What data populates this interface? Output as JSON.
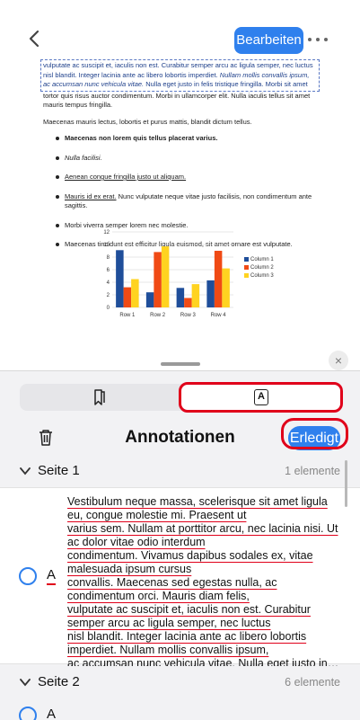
{
  "toolbar": {
    "edit_label": "Bearbeiten"
  },
  "document": {
    "highlight_lines": [
      "vulputate ac suscipit et, iaculis non est. Curabitur semper arcu ac ligula semper, nec luctus",
      "nisl blandit. Integer lacinia ante ac libero lobortis imperdiet.",
      "Nullam mollis convallis ipsum,",
      "ac accumsan nunc vehicula vitae.",
      "Nulla eget justo in felis tristique fringilla. Morbi sit amet"
    ],
    "para1_rest": "tortor quis risus auctor condimentum. Morbi in ullamcorper elit. Nulla iaculis tellus sit amet mauris tempus fringilla.",
    "para2": "Maecenas mauris lectus, lobortis et purus mattis, blandit dictum tellus.",
    "bullets": [
      "Maecenas non lorem quis tellus placerat varius.",
      "Nulla facilisi.",
      "Aenean congue fringilla justo ut aliquam.",
      "Mauris id ex erat.",
      "Nunc vulputate neque vitae justo facilisis, non condimentum ante sagittis.",
      "Morbi viverra semper lorem nec molestie.",
      "Maecenas tincidunt est efficitur ligula euismod, sit amet ornare est vulputate."
    ]
  },
  "chart_data": {
    "type": "bar",
    "categories": [
      "Row 1",
      "Row 2",
      "Row 3",
      "Row 4"
    ],
    "series": [
      {
        "name": "Column 1",
        "values": [
          9.1,
          2.4,
          3.1,
          4.3
        ],
        "color": "#1f4e9a"
      },
      {
        "name": "Column 2",
        "values": [
          3.2,
          8.8,
          1.5,
          9.0
        ],
        "color": "#f04a15"
      },
      {
        "name": "Column 3",
        "values": [
          4.5,
          9.7,
          3.7,
          6.2
        ],
        "color": "#ffd320"
      }
    ],
    "ylim": [
      0,
      12
    ],
    "yticks": [
      "0",
      "2",
      "4",
      "6",
      "8",
      "10",
      "12"
    ],
    "grid": true,
    "legend": "right"
  },
  "sheet": {
    "title": "Annotationen",
    "done_label": "Erledigt",
    "close_symbol": "×",
    "annot_tab_letter": "A"
  },
  "sections": [
    {
      "label": "Seite 1",
      "count": "1 elemente"
    },
    {
      "label": "Seite 2",
      "count": "6 elemente"
    }
  ],
  "annotation": {
    "glyph": "A",
    "lines": [
      "Vestibulum neque massa, scelerisque sit amet ligula",
      "eu, congue molestie mi. Praesent ut",
      "varius sem. Nullam at porttitor arcu, nec lacinia nisi. Ut",
      "ac dolor vitae odio interdum",
      "condimentum. Vivamus dapibus sodales ex, vitae",
      "malesuada ipsum cursus",
      "convallis. Maecenas sed egestas nulla, ac",
      "condimentum orci. Mauris diam felis,",
      "vulputate ac suscipit et, iaculis non est. Curabitur",
      "semper arcu ac ligula semper, nec luctus",
      "nisl blandit. Integer lacinia ante ac libero lobortis",
      "imperdiet. Nullam mollis convallis ipsum,",
      "ac accumsan nunc vehicula vitae. Nulla eget justo in f..."
    ]
  },
  "colors": {
    "accent": "#2f80ed",
    "highlight_ring": "#e0001a"
  },
  "icons": [
    "chevron-left-icon",
    "more-icon",
    "bookmark-icon",
    "annotation-icon",
    "trash-icon",
    "chevron-down-icon",
    "close-icon"
  ]
}
